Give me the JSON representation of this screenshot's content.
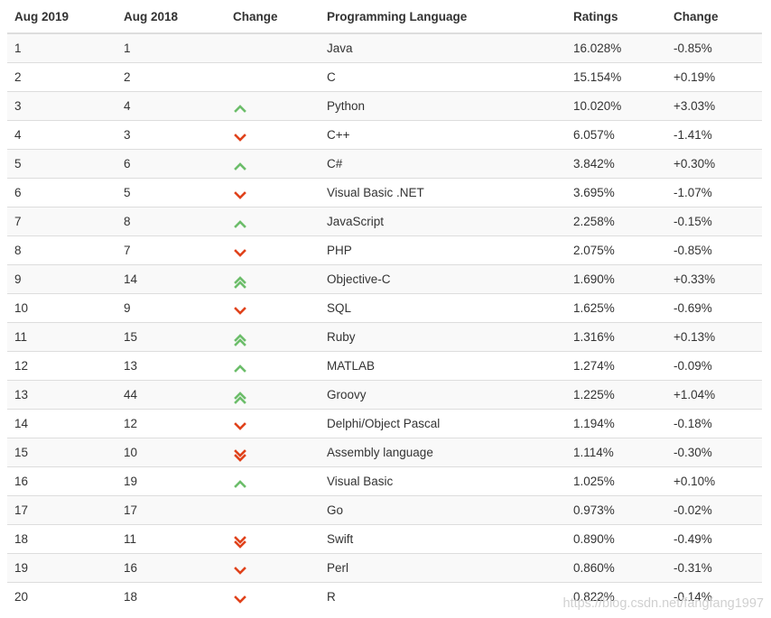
{
  "headers": [
    "Aug 2019",
    "Aug 2018",
    "Change",
    "Programming Language",
    "Ratings",
    "Change"
  ],
  "colors": {
    "up": "#6cbd6a",
    "down": "#e0421b",
    "border": "#dddddd",
    "stripe": "#f9f9f9"
  },
  "rows": [
    {
      "rank2019": "1",
      "rank2018": "1",
      "trend": "none",
      "language": "Java",
      "rating": "16.028%",
      "change": "-0.85%"
    },
    {
      "rank2019": "2",
      "rank2018": "2",
      "trend": "none",
      "language": "C",
      "rating": "15.154%",
      "change": "+0.19%"
    },
    {
      "rank2019": "3",
      "rank2018": "4",
      "trend": "up",
      "language": "Python",
      "rating": "10.020%",
      "change": "+3.03%"
    },
    {
      "rank2019": "4",
      "rank2018": "3",
      "trend": "down",
      "language": "C++",
      "rating": "6.057%",
      "change": "-1.41%"
    },
    {
      "rank2019": "5",
      "rank2018": "6",
      "trend": "up",
      "language": "C#",
      "rating": "3.842%",
      "change": "+0.30%"
    },
    {
      "rank2019": "6",
      "rank2018": "5",
      "trend": "down",
      "language": "Visual Basic .NET",
      "rating": "3.695%",
      "change": "-1.07%"
    },
    {
      "rank2019": "7",
      "rank2018": "8",
      "trend": "up",
      "language": "JavaScript",
      "rating": "2.258%",
      "change": "-0.15%"
    },
    {
      "rank2019": "8",
      "rank2018": "7",
      "trend": "down",
      "language": "PHP",
      "rating": "2.075%",
      "change": "-0.85%"
    },
    {
      "rank2019": "9",
      "rank2018": "14",
      "trend": "up2",
      "language": "Objective-C",
      "rating": "1.690%",
      "change": "+0.33%"
    },
    {
      "rank2019": "10",
      "rank2018": "9",
      "trend": "down",
      "language": "SQL",
      "rating": "1.625%",
      "change": "-0.69%"
    },
    {
      "rank2019": "11",
      "rank2018": "15",
      "trend": "up2",
      "language": "Ruby",
      "rating": "1.316%",
      "change": "+0.13%"
    },
    {
      "rank2019": "12",
      "rank2018": "13",
      "trend": "up",
      "language": "MATLAB",
      "rating": "1.274%",
      "change": "-0.09%"
    },
    {
      "rank2019": "13",
      "rank2018": "44",
      "trend": "up2",
      "language": "Groovy",
      "rating": "1.225%",
      "change": "+1.04%"
    },
    {
      "rank2019": "14",
      "rank2018": "12",
      "trend": "down",
      "language": "Delphi/Object Pascal",
      "rating": "1.194%",
      "change": "-0.18%"
    },
    {
      "rank2019": "15",
      "rank2018": "10",
      "trend": "down2",
      "language": "Assembly language",
      "rating": "1.114%",
      "change": "-0.30%"
    },
    {
      "rank2019": "16",
      "rank2018": "19",
      "trend": "up",
      "language": "Visual Basic",
      "rating": "1.025%",
      "change": "+0.10%"
    },
    {
      "rank2019": "17",
      "rank2018": "17",
      "trend": "none",
      "language": "Go",
      "rating": "0.973%",
      "change": "-0.02%"
    },
    {
      "rank2019": "18",
      "rank2018": "11",
      "trend": "down2",
      "language": "Swift",
      "rating": "0.890%",
      "change": "-0.49%"
    },
    {
      "rank2019": "19",
      "rank2018": "16",
      "trend": "down",
      "language": "Perl",
      "rating": "0.860%",
      "change": "-0.31%"
    },
    {
      "rank2019": "20",
      "rank2018": "18",
      "trend": "down",
      "language": "R",
      "rating": "0.822%",
      "change": "-0.14%"
    }
  ],
  "watermark": "https://blog.csdn.net/fangfang1997"
}
